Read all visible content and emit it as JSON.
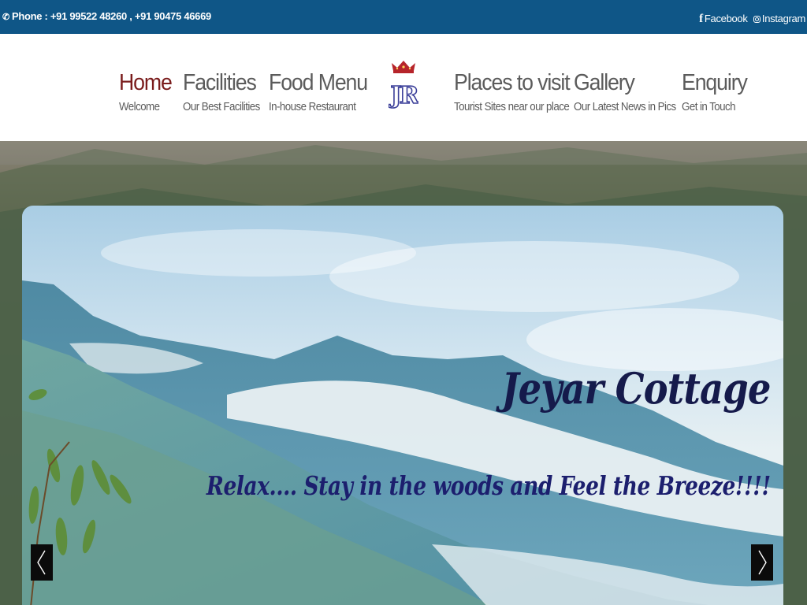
{
  "topbar": {
    "phone_icon": "phone-icon",
    "phone_text": "Phone : +91 99522 48260 , +91 90475 46669",
    "facebook_label": "Facebook",
    "instagram_label": "Instagram"
  },
  "nav": {
    "items": [
      {
        "title": "Home",
        "sub": "Welcome",
        "active": true
      },
      {
        "title": "Facilities",
        "sub": "Our Best Facilities"
      },
      {
        "title": "Food Menu",
        "sub": "In-house Restaurant"
      },
      {
        "title": "Places to visit",
        "sub": "Tourist Sites near our place"
      },
      {
        "title": "Gallery",
        "sub": "Our Latest News in Pics"
      },
      {
        "title": "Enquiry",
        "sub": "Get in Touch"
      }
    ],
    "logo_text": "JR"
  },
  "hero": {
    "headline": "Jeyar Cottage",
    "tagline": "Relax.... Stay in the woods and Feel the Breeze!!!!",
    "prev_icon": "chevron-left-icon",
    "next_icon": "chevron-right-icon"
  },
  "colors": {
    "topbar_bg": "#0f5687",
    "active_nav": "#7a1c1c",
    "nav_text": "#5b5b5b",
    "headline": "#151a4b",
    "tagline": "#1c1f6e"
  }
}
